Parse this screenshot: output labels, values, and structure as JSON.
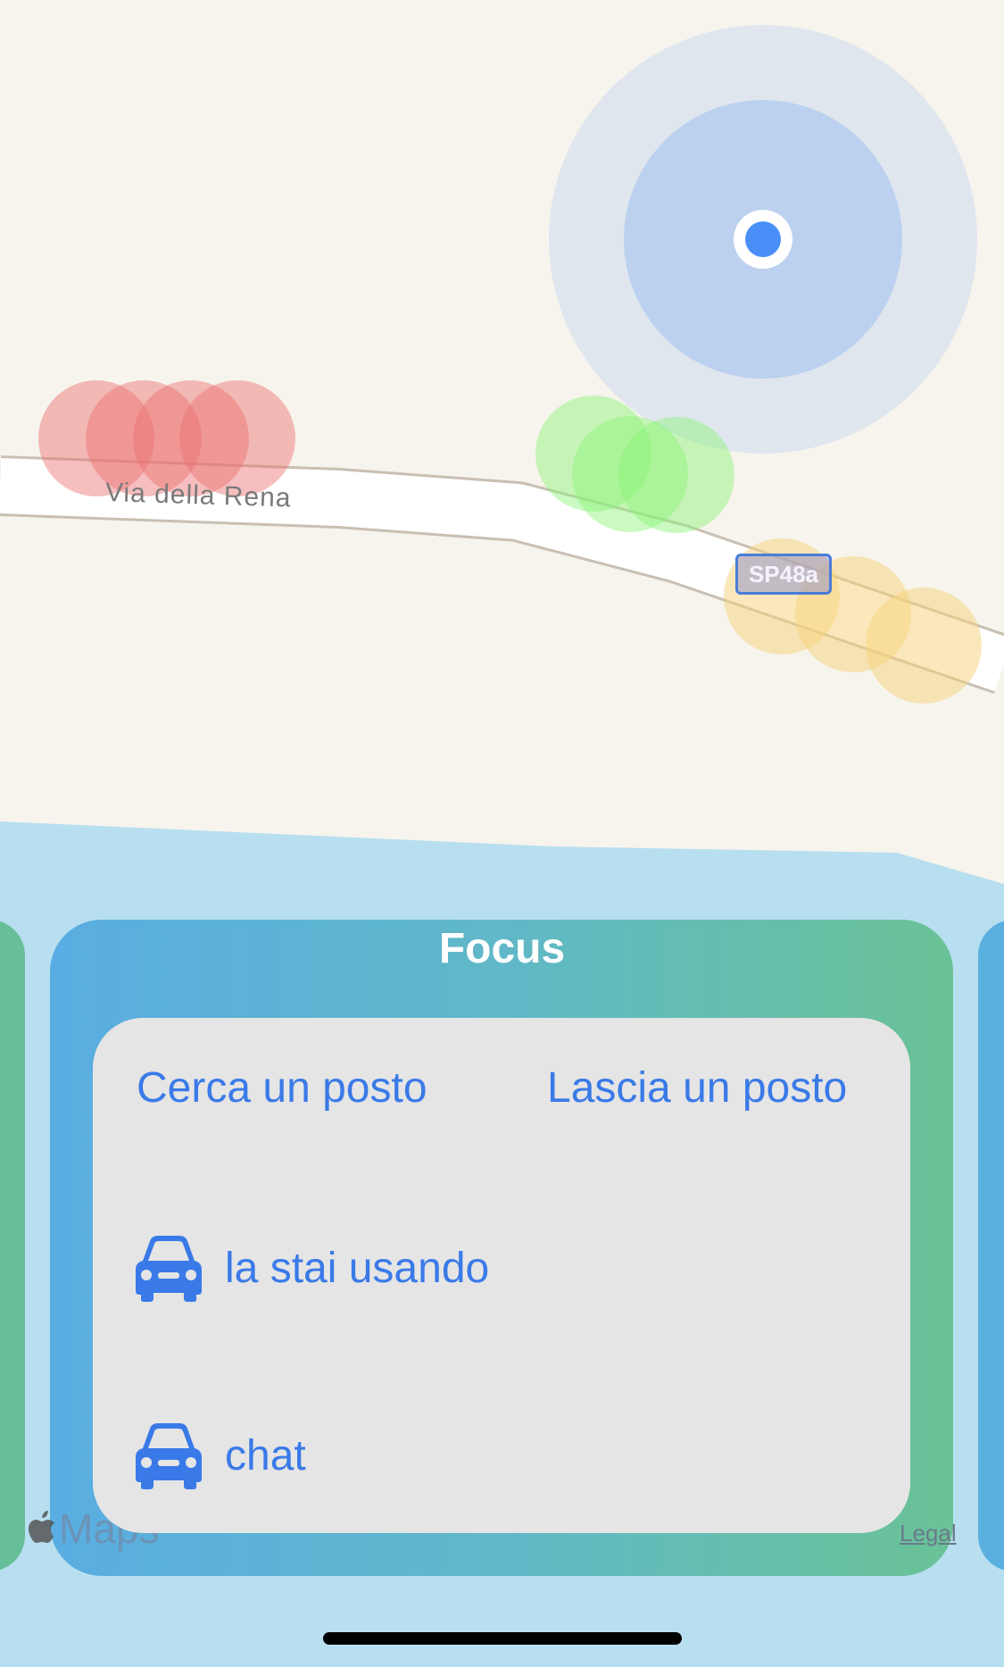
{
  "map": {
    "road_name": "Via della Rena",
    "road_shield": "SP48a"
  },
  "focus": {
    "title": "Focus",
    "search_spot": "Cerca un posto",
    "leave_spot": "Lascia un posto",
    "in_use": "la stai usando",
    "chat": "chat"
  },
  "footer": {
    "maps_brand": "Maps",
    "legal": "Legal"
  },
  "icons": {
    "car_icon": "car-icon",
    "location": "user-location-dot-icon",
    "apple_logo": "apple-logo-icon"
  },
  "colors": {
    "accent": "#3a7ae8",
    "location_blue": "#4a8ff7",
    "marker_red": "#ec6e6e",
    "marker_green": "#8af576",
    "marker_yellow": "#f5d27a",
    "water": "#b8dff0",
    "land": "#f7f4ed"
  }
}
